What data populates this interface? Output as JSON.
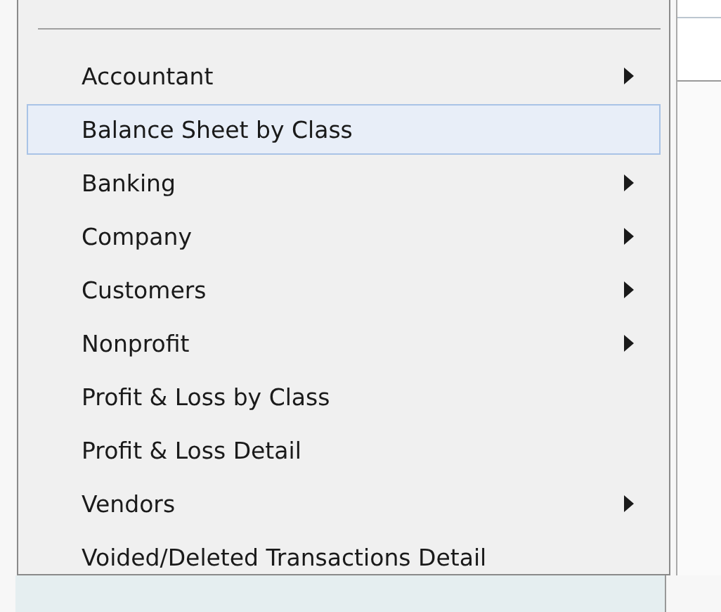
{
  "menu": {
    "items": [
      {
        "label": "Accountant",
        "submenu": true,
        "selected": false
      },
      {
        "label": "Balance Sheet by Class",
        "submenu": false,
        "selected": true
      },
      {
        "label": "Banking",
        "submenu": true,
        "selected": false
      },
      {
        "label": "Company",
        "submenu": true,
        "selected": false
      },
      {
        "label": "Customers",
        "submenu": true,
        "selected": false
      },
      {
        "label": "Nonprofit",
        "submenu": true,
        "selected": false
      },
      {
        "label": "Profit & Loss by Class",
        "submenu": false,
        "selected": false
      },
      {
        "label": "Profit & Loss Detail",
        "submenu": false,
        "selected": false
      },
      {
        "label": "Vendors",
        "submenu": true,
        "selected": false
      },
      {
        "label": "Voided/Deleted Transactions Detail",
        "submenu": false,
        "selected": false
      }
    ]
  }
}
